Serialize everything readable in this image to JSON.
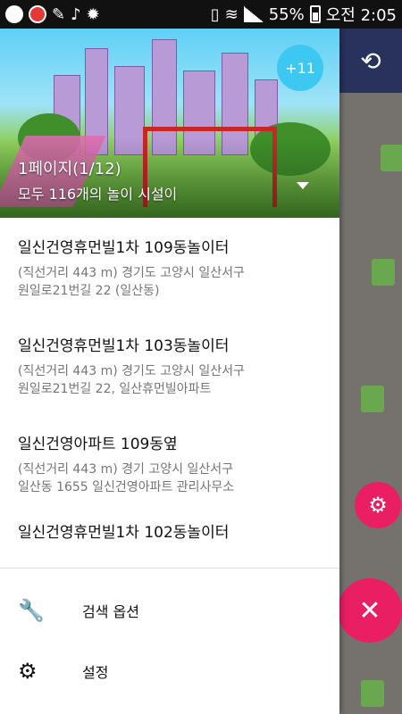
{
  "status_bar": {
    "battery": "55%",
    "time": "오전 2:05"
  },
  "header": {
    "page_indicator": "1페이지(1/12)",
    "total": "모두 116개의 놀이 시설이",
    "badge": "+11"
  },
  "places": [
    {
      "title": "일신건영휴먼빌1차 109동놀이터",
      "line1": "(직선거리 443 m) 경기도 고양시 일산서구",
      "line2": "원일로21번길 22 (일산동)"
    },
    {
      "title": "일신건영휴먼빌1차 103동놀이터",
      "line1": "(직선거리 443 m) 경기도 고양시 일산서구",
      "line2": "원일로21번길 22, 일산휴먼빌아파트"
    },
    {
      "title": "일신건영아파트 109동옆",
      "line1": "(직선거리 443 m) 경기 고양시 일산서구",
      "line2": "일산동 1655 일신건영아파트 관리사무소"
    },
    {
      "title": "일신건영휴먼빌1차 102동놀이터",
      "line1": "",
      "line2": ""
    }
  ],
  "menu": {
    "search_options": "검색 옵션",
    "settings": "설정"
  },
  "icons": {
    "search_options": "wrench-icon",
    "settings": "gear-icon",
    "refresh": "refresh-search-icon",
    "close": "close-icon"
  },
  "colors": {
    "appbar": "#28325c",
    "fab": "#e91e63",
    "badge": "#3cc8f0"
  }
}
